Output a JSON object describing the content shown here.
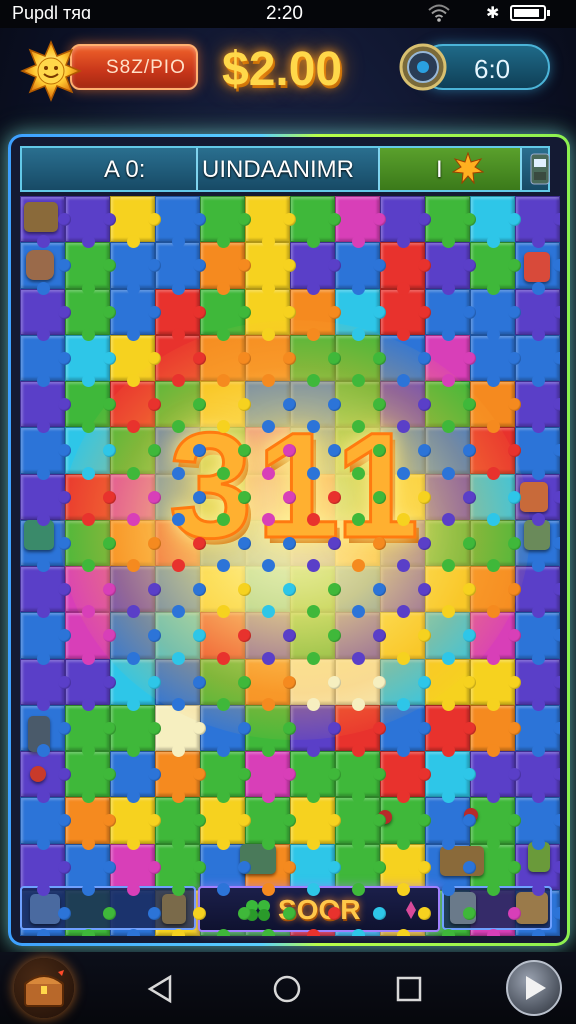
{
  "status_bar": {
    "carrier": "Pupdl ᴛᴙɑ",
    "time": "2:20",
    "battery_level": 0.9
  },
  "hud": {
    "score_label": "S8Z/PIO",
    "money": "$2.00",
    "timer": "6:0",
    "sun_icon": "sun-icon",
    "clock_icon": "clock-icon"
  },
  "header": {
    "left_text": "A 0:",
    "center_text": "UINDAANIMR",
    "right_text": "I"
  },
  "board": {
    "overlay_number": "311",
    "tile_colors": {
      "red": "#e8322d",
      "orange": "#f58a1f",
      "yellow": "#f6d21f",
      "green": "#3fb83a",
      "blue": "#2c74d8",
      "cyan": "#2ec6e8",
      "purple": "#5a3fc8",
      "magenta": "#d83fb8",
      "cream": "#f6efc0"
    }
  },
  "bottom": {
    "soor_label": "SOOR"
  },
  "nav": {
    "back_icon": "back-triangle-icon",
    "home_icon": "home-circle-icon",
    "recents_icon": "recents-square-icon"
  }
}
